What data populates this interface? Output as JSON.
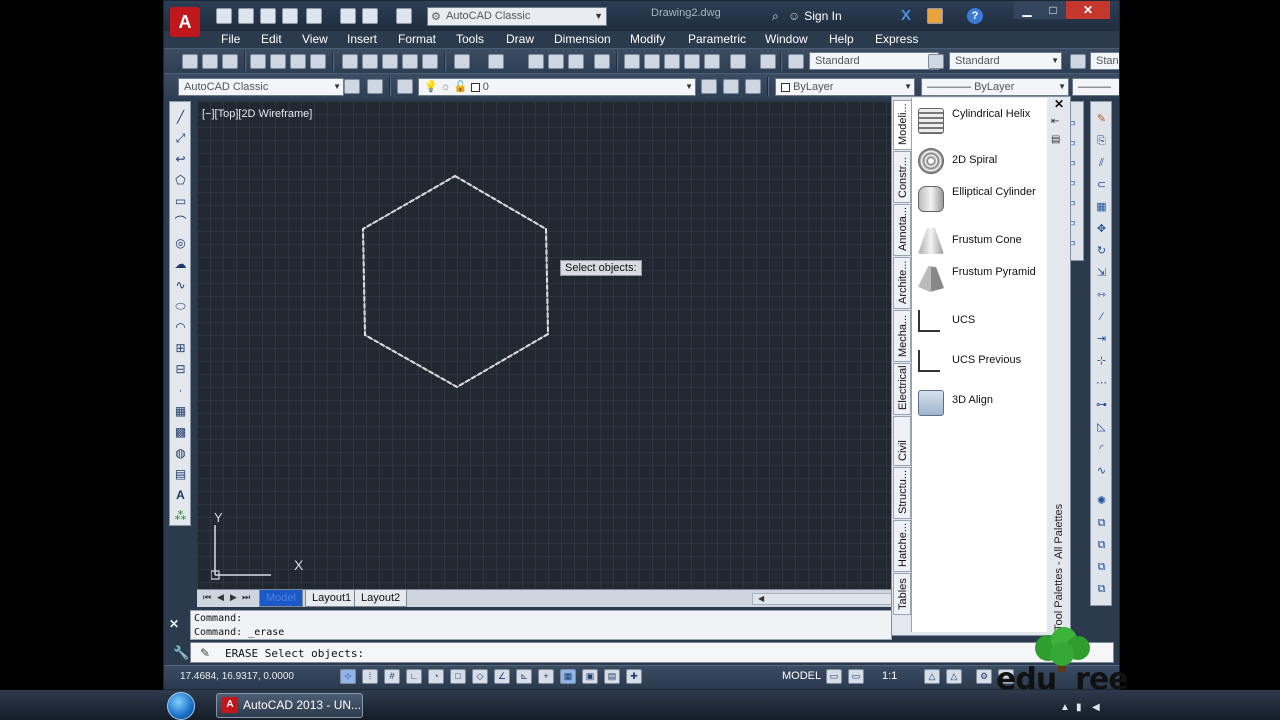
{
  "titlebar": {
    "workspace": "AutoCAD Classic",
    "document_title": "Drawing2.dwg",
    "sign_in": "Sign In"
  },
  "menu": [
    "File",
    "Edit",
    "View",
    "Insert",
    "Format",
    "Tools",
    "Draw",
    "Dimension",
    "Modify",
    "Parametric",
    "Window",
    "Help",
    "Express"
  ],
  "toolbar1": {
    "text_style": "Standard",
    "dim_style": "Standard",
    "table_style": "Stan"
  },
  "toolbar2": {
    "workspace": "AutoCAD Classic",
    "layer": "0",
    "color": "ByLayer",
    "linetype": "ByLayer"
  },
  "viewport": {
    "label": "[−][Top][2D Wireframe]",
    "tooltip": "Select objects:",
    "ucs_x": "X",
    "ucs_y": "Y"
  },
  "layout_tabs": [
    "Model",
    "Layout1",
    "Layout2"
  ],
  "command": {
    "history": [
      "Command:",
      "Command: _erase"
    ],
    "current": "ERASE Select objects:"
  },
  "status": {
    "coords": "17.4684, 16.9317, 0.0000",
    "model": "MODEL",
    "scale": "1:1"
  },
  "palette": {
    "title": "Tool Palettes - All Palettes",
    "tabs": [
      "Modeli...",
      "Constr...",
      "Annota...",
      "Archite...",
      "Mecha...",
      "Electrical",
      "Civil",
      "Structu...",
      "Hatche...",
      "Tables"
    ],
    "items": [
      {
        "label": "Cylindrical Helix",
        "icon": "helix-icon"
      },
      {
        "label": "2D Spiral",
        "icon": "spiral-icon"
      },
      {
        "label": "Elliptical Cylinder",
        "icon": "cylinder-icon"
      },
      {
        "label": "Frustum Cone",
        "icon": "cone-icon"
      },
      {
        "label": "Frustum Pyramid",
        "icon": "pyramid-icon"
      },
      {
        "label": "UCS",
        "icon": "ucs-icon"
      },
      {
        "label": "UCS Previous",
        "icon": "ucs-previous-icon"
      },
      {
        "label": "3D Align",
        "icon": "align-3d-icon"
      }
    ]
  },
  "taskbar": {
    "app_button": "AutoCAD 2013 - UN..."
  },
  "watermark": "edureka"
}
